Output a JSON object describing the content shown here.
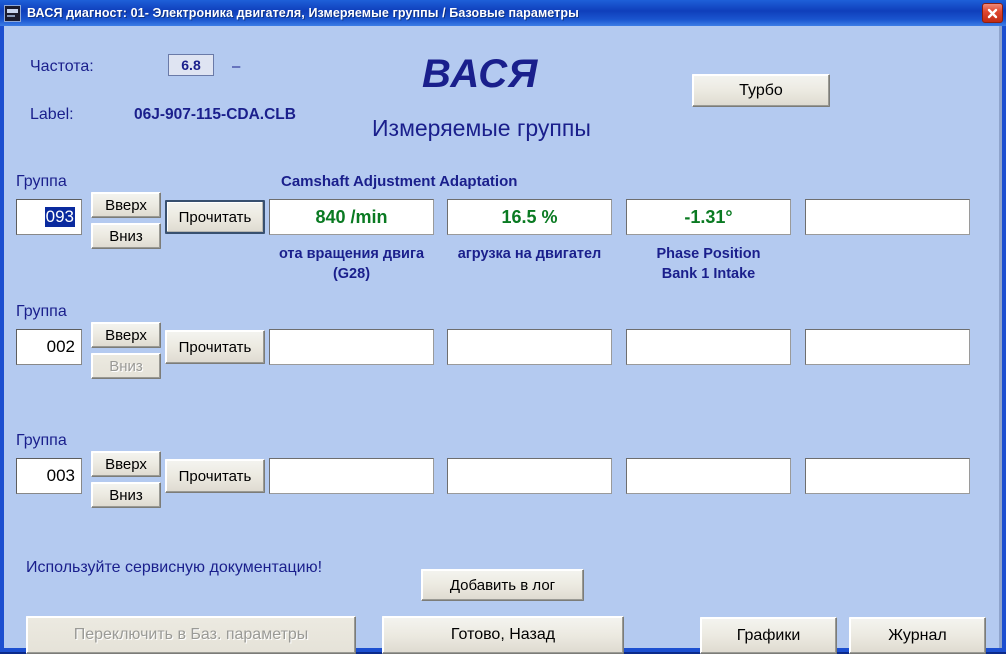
{
  "window": {
    "title": "ВАСЯ диагност: 01- Электроника двигателя,  Измеряемые группы / Базовые параметры",
    "close_label": "✕",
    "icon": "vasya-app-icon"
  },
  "header": {
    "freq_label": "Частота:",
    "freq_value": "6.8",
    "freq_unit": "–",
    "label_label": "Label:",
    "label_value": "06J-907-115-CDA.CLB",
    "brand": "ВАСЯ",
    "subtitle": "Измеряемые группы",
    "turbo_label": "Турбо"
  },
  "adaptation_title": "Camshaft Adjustment Adaptation",
  "rows": [
    {
      "group_title": "Группа",
      "group_number": "093",
      "selected": true,
      "up_label": "Вверх",
      "down_label": "Вниз",
      "down_disabled": false,
      "read_label": "Прочитать",
      "read_focused": true,
      "fields": [
        {
          "value": "840 /min",
          "caption_line1": "ота вращения двига",
          "caption_line2": "(G28)"
        },
        {
          "value": "16.5 %",
          "caption_line1": "агрузка на двигател",
          "caption_line2": ""
        },
        {
          "value": "-1.31°",
          "caption_line1": "Phase Position",
          "caption_line2": "Bank 1 Intake"
        },
        {
          "value": "",
          "caption_line1": "",
          "caption_line2": ""
        }
      ]
    },
    {
      "group_title": "Группа",
      "group_number": "002",
      "selected": false,
      "up_label": "Вверх",
      "down_label": "Вниз",
      "down_disabled": true,
      "read_label": "Прочитать",
      "read_focused": false,
      "fields": [
        {
          "value": "",
          "caption_line1": "",
          "caption_line2": ""
        },
        {
          "value": "",
          "caption_line1": "",
          "caption_line2": ""
        },
        {
          "value": "",
          "caption_line1": "",
          "caption_line2": ""
        },
        {
          "value": "",
          "caption_line1": "",
          "caption_line2": ""
        }
      ]
    },
    {
      "group_title": "Группа",
      "group_number": "003",
      "selected": false,
      "up_label": "Вверх",
      "down_label": "Вниз",
      "down_disabled": false,
      "read_label": "Прочитать",
      "read_focused": false,
      "fields": [
        {
          "value": "",
          "caption_line1": "",
          "caption_line2": ""
        },
        {
          "value": "",
          "caption_line1": "",
          "caption_line2": ""
        },
        {
          "value": "",
          "caption_line1": "",
          "caption_line2": ""
        },
        {
          "value": "",
          "caption_line1": "",
          "caption_line2": ""
        }
      ]
    }
  ],
  "footer": {
    "hint": "Используйте сервисную документацию!",
    "add_log_label": "Добавить в лог",
    "switch_label": "Переключить в Баз. параметры",
    "switch_disabled": true,
    "done_label": "Готово, Назад",
    "graphs_label": "Графики",
    "journal_label": "Журнал"
  },
  "colors": {
    "client_bg": "#b4caf0",
    "title_bar": "#1447c8",
    "accent_text": "#1a1f8c",
    "value_green": "#0a7a22",
    "close_red": "#d03a20",
    "selection_blue": "#0a2a9e"
  }
}
